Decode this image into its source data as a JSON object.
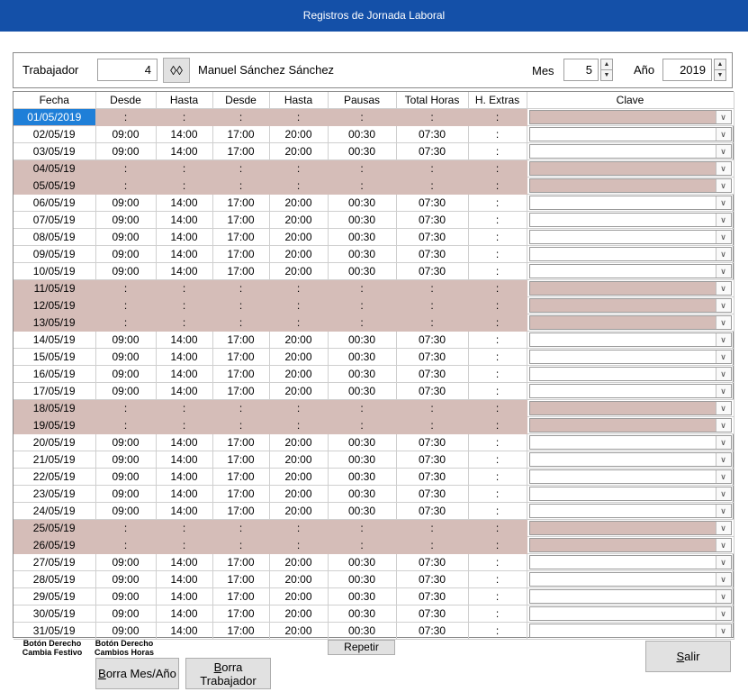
{
  "window": {
    "title": "Registros de Jornada Laboral"
  },
  "header": {
    "worker_label": "Trabajador",
    "worker_id": "4",
    "worker_name": "Manuel Sánchez Sánchez",
    "month_label": "Mes",
    "month_value": "5",
    "year_label": "Año",
    "year_value": "2019",
    "search_icon": "binoculars-icon"
  },
  "columns": [
    "Fecha",
    "Desde",
    "Hasta",
    "Desde",
    "Hasta",
    "Pausas",
    "Total Horas",
    "H. Extras",
    "Clave"
  ],
  "colors": {
    "holiday_row": "#d5bdb8",
    "selected": "#1f7fd8",
    "titlebar": "#1450a8"
  },
  "rows": [
    {
      "fecha": "01/05/2019",
      "d1": ":",
      "h1": ":",
      "d2": ":",
      "h2": ":",
      "pausas": ":",
      "total": ":",
      "extras": ":",
      "holiday": true,
      "selected": true
    },
    {
      "fecha": "02/05/19",
      "d1": "09:00",
      "h1": "14:00",
      "d2": "17:00",
      "h2": "20:00",
      "pausas": "00:30",
      "total": "07:30",
      "extras": ":",
      "holiday": false
    },
    {
      "fecha": "03/05/19",
      "d1": "09:00",
      "h1": "14:00",
      "d2": "17:00",
      "h2": "20:00",
      "pausas": "00:30",
      "total": "07:30",
      "extras": ":",
      "holiday": false
    },
    {
      "fecha": "04/05/19",
      "d1": ":",
      "h1": ":",
      "d2": ":",
      "h2": ":",
      "pausas": ":",
      "total": ":",
      "extras": ":",
      "holiday": true
    },
    {
      "fecha": "05/05/19",
      "d1": ":",
      "h1": ":",
      "d2": ":",
      "h2": ":",
      "pausas": ":",
      "total": ":",
      "extras": ":",
      "holiday": true
    },
    {
      "fecha": "06/05/19",
      "d1": "09:00",
      "h1": "14:00",
      "d2": "17:00",
      "h2": "20:00",
      "pausas": "00:30",
      "total": "07:30",
      "extras": ":",
      "holiday": false
    },
    {
      "fecha": "07/05/19",
      "d1": "09:00",
      "h1": "14:00",
      "d2": "17:00",
      "h2": "20:00",
      "pausas": "00:30",
      "total": "07:30",
      "extras": ":",
      "holiday": false
    },
    {
      "fecha": "08/05/19",
      "d1": "09:00",
      "h1": "14:00",
      "d2": "17:00",
      "h2": "20:00",
      "pausas": "00:30",
      "total": "07:30",
      "extras": ":",
      "holiday": false
    },
    {
      "fecha": "09/05/19",
      "d1": "09:00",
      "h1": "14:00",
      "d2": "17:00",
      "h2": "20:00",
      "pausas": "00:30",
      "total": "07:30",
      "extras": ":",
      "holiday": false
    },
    {
      "fecha": "10/05/19",
      "d1": "09:00",
      "h1": "14:00",
      "d2": "17:00",
      "h2": "20:00",
      "pausas": "00:30",
      "total": "07:30",
      "extras": ":",
      "holiday": false
    },
    {
      "fecha": "11/05/19",
      "d1": ":",
      "h1": ":",
      "d2": ":",
      "h2": ":",
      "pausas": ":",
      "total": ":",
      "extras": ":",
      "holiday": true
    },
    {
      "fecha": "12/05/19",
      "d1": ":",
      "h1": ":",
      "d2": ":",
      "h2": ":",
      "pausas": ":",
      "total": ":",
      "extras": ":",
      "holiday": true
    },
    {
      "fecha": "13/05/19",
      "d1": ":",
      "h1": ":",
      "d2": ":",
      "h2": ":",
      "pausas": ":",
      "total": ":",
      "extras": ":",
      "holiday": true
    },
    {
      "fecha": "14/05/19",
      "d1": "09:00",
      "h1": "14:00",
      "d2": "17:00",
      "h2": "20:00",
      "pausas": "00:30",
      "total": "07:30",
      "extras": ":",
      "holiday": false
    },
    {
      "fecha": "15/05/19",
      "d1": "09:00",
      "h1": "14:00",
      "d2": "17:00",
      "h2": "20:00",
      "pausas": "00:30",
      "total": "07:30",
      "extras": ":",
      "holiday": false
    },
    {
      "fecha": "16/05/19",
      "d1": "09:00",
      "h1": "14:00",
      "d2": "17:00",
      "h2": "20:00",
      "pausas": "00:30",
      "total": "07:30",
      "extras": ":",
      "holiday": false
    },
    {
      "fecha": "17/05/19",
      "d1": "09:00",
      "h1": "14:00",
      "d2": "17:00",
      "h2": "20:00",
      "pausas": "00:30",
      "total": "07:30",
      "extras": ":",
      "holiday": false
    },
    {
      "fecha": "18/05/19",
      "d1": ":",
      "h1": ":",
      "d2": ":",
      "h2": ":",
      "pausas": ":",
      "total": ":",
      "extras": ":",
      "holiday": true
    },
    {
      "fecha": "19/05/19",
      "d1": ":",
      "h1": ":",
      "d2": ":",
      "h2": ":",
      "pausas": ":",
      "total": ":",
      "extras": ":",
      "holiday": true
    },
    {
      "fecha": "20/05/19",
      "d1": "09:00",
      "h1": "14:00",
      "d2": "17:00",
      "h2": "20:00",
      "pausas": "00:30",
      "total": "07:30",
      "extras": ":",
      "holiday": false
    },
    {
      "fecha": "21/05/19",
      "d1": "09:00",
      "h1": "14:00",
      "d2": "17:00",
      "h2": "20:00",
      "pausas": "00:30",
      "total": "07:30",
      "extras": ":",
      "holiday": false
    },
    {
      "fecha": "22/05/19",
      "d1": "09:00",
      "h1": "14:00",
      "d2": "17:00",
      "h2": "20:00",
      "pausas": "00:30",
      "total": "07:30",
      "extras": ":",
      "holiday": false
    },
    {
      "fecha": "23/05/19",
      "d1": "09:00",
      "h1": "14:00",
      "d2": "17:00",
      "h2": "20:00",
      "pausas": "00:30",
      "total": "07:30",
      "extras": ":",
      "holiday": false
    },
    {
      "fecha": "24/05/19",
      "d1": "09:00",
      "h1": "14:00",
      "d2": "17:00",
      "h2": "20:00",
      "pausas": "00:30",
      "total": "07:30",
      "extras": ":",
      "holiday": false
    },
    {
      "fecha": "25/05/19",
      "d1": ":",
      "h1": ":",
      "d2": ":",
      "h2": ":",
      "pausas": ":",
      "total": ":",
      "extras": ":",
      "holiday": true
    },
    {
      "fecha": "26/05/19",
      "d1": ":",
      "h1": ":",
      "d2": ":",
      "h2": ":",
      "pausas": ":",
      "total": ":",
      "extras": ":",
      "holiday": true
    },
    {
      "fecha": "27/05/19",
      "d1": "09:00",
      "h1": "14:00",
      "d2": "17:00",
      "h2": "20:00",
      "pausas": "00:30",
      "total": "07:30",
      "extras": ":",
      "holiday": false
    },
    {
      "fecha": "28/05/19",
      "d1": "09:00",
      "h1": "14:00",
      "d2": "17:00",
      "h2": "20:00",
      "pausas": "00:30",
      "total": "07:30",
      "extras": ":",
      "holiday": false
    },
    {
      "fecha": "29/05/19",
      "d1": "09:00",
      "h1": "14:00",
      "d2": "17:00",
      "h2": "20:00",
      "pausas": "00:30",
      "total": "07:30",
      "extras": ":",
      "holiday": false
    },
    {
      "fecha": "30/05/19",
      "d1": "09:00",
      "h1": "14:00",
      "d2": "17:00",
      "h2": "20:00",
      "pausas": "00:30",
      "total": "07:30",
      "extras": ":",
      "holiday": false
    },
    {
      "fecha": "31/05/19",
      "d1": "09:00",
      "h1": "14:00",
      "d2": "17:00",
      "h2": "20:00",
      "pausas": "00:30",
      "total": "07:30",
      "extras": ":",
      "holiday": false
    }
  ],
  "footer": {
    "note1_line1": "Botón Derecho",
    "note1_line2": "Cambia Festivo",
    "note2_line1": "Botón Derecho",
    "note2_line2": "Cambios Horas",
    "repetir": "Repetir",
    "borra_mes_accel": "B",
    "borra_mes_rest": "orra Mes/Año",
    "borra_trab_accel": "B",
    "borra_trab_rest": "orra",
    "borra_trab_line2": "Trabajador",
    "salir_accel": "S",
    "salir_rest": "alir"
  }
}
